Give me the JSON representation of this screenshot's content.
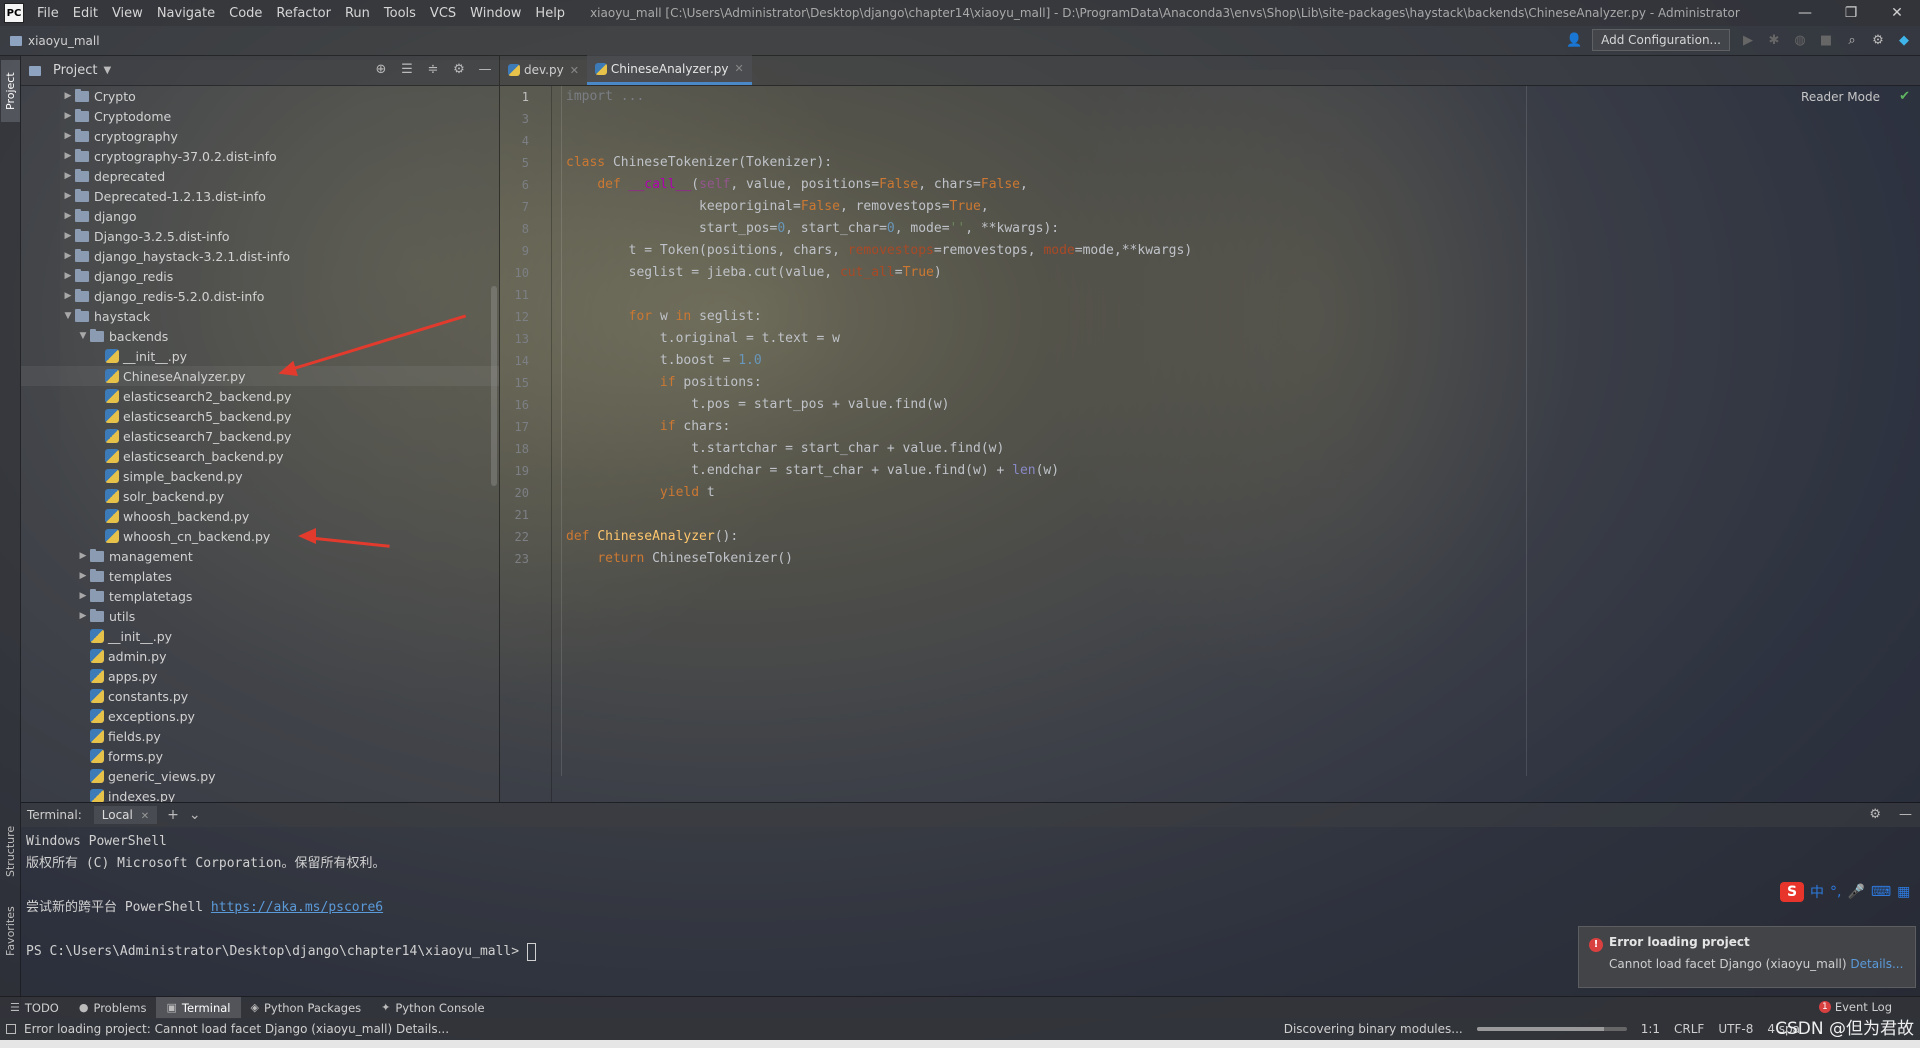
{
  "app": {
    "logo": "PC",
    "title": "xiaoyu_mall [C:\\Users\\Administrator\\Desktop\\django\\chapter14\\xiaoyu_mall] - D:\\ProgramData\\Anaconda3\\envs\\Shop\\Lib\\site-packages\\haystack\\backends\\ChineseAnalyzer.py - Administrator",
    "menu": [
      "File",
      "Edit",
      "View",
      "Navigate",
      "Code",
      "Refactor",
      "Run",
      "Tools",
      "VCS",
      "Window",
      "Help"
    ],
    "window_controls": [
      "—",
      "❐",
      "✕"
    ]
  },
  "navbar": {
    "breadcrumb": "xiaoyu_mall",
    "add_configuration": "Add Configuration..."
  },
  "left_stripe": {
    "project": "Project",
    "structure": "Structure",
    "favorites": "Favorites"
  },
  "project_panel": {
    "title": "Project",
    "tree": [
      {
        "label": "Crypto",
        "type": "folder",
        "depth": 3,
        "expanded": false
      },
      {
        "label": "Cryptodome",
        "type": "folder",
        "depth": 3,
        "expanded": false
      },
      {
        "label": "cryptography",
        "type": "folder",
        "depth": 3,
        "expanded": false
      },
      {
        "label": "cryptography-37.0.2.dist-info",
        "type": "folder",
        "depth": 3,
        "expanded": false
      },
      {
        "label": "deprecated",
        "type": "folder",
        "depth": 3,
        "expanded": false
      },
      {
        "label": "Deprecated-1.2.13.dist-info",
        "type": "folder",
        "depth": 3,
        "expanded": false
      },
      {
        "label": "django",
        "type": "folder",
        "depth": 3,
        "expanded": false
      },
      {
        "label": "Django-3.2.5.dist-info",
        "type": "folder",
        "depth": 3,
        "expanded": false
      },
      {
        "label": "django_haystack-3.2.1.dist-info",
        "type": "folder",
        "depth": 3,
        "expanded": false
      },
      {
        "label": "django_redis",
        "type": "folder",
        "depth": 3,
        "expanded": false
      },
      {
        "label": "django_redis-5.2.0.dist-info",
        "type": "folder",
        "depth": 3,
        "expanded": false
      },
      {
        "label": "haystack",
        "type": "folder",
        "depth": 3,
        "expanded": true
      },
      {
        "label": "backends",
        "type": "folder",
        "depth": 4,
        "expanded": true
      },
      {
        "label": "__init__.py",
        "type": "py",
        "depth": 5
      },
      {
        "label": "ChineseAnalyzer.py",
        "type": "py",
        "depth": 5
      },
      {
        "label": "elasticsearch2_backend.py",
        "type": "py",
        "depth": 5
      },
      {
        "label": "elasticsearch5_backend.py",
        "type": "py",
        "depth": 5
      },
      {
        "label": "elasticsearch7_backend.py",
        "type": "py",
        "depth": 5
      },
      {
        "label": "elasticsearch_backend.py",
        "type": "py",
        "depth": 5
      },
      {
        "label": "simple_backend.py",
        "type": "py",
        "depth": 5
      },
      {
        "label": "solr_backend.py",
        "type": "py",
        "depth": 5
      },
      {
        "label": "whoosh_backend.py",
        "type": "py",
        "depth": 5
      },
      {
        "label": "whoosh_cn_backend.py",
        "type": "py",
        "depth": 5
      },
      {
        "label": "management",
        "type": "folder",
        "depth": 4,
        "expanded": false
      },
      {
        "label": "templates",
        "type": "folder",
        "depth": 4,
        "expanded": false
      },
      {
        "label": "templatetags",
        "type": "folder",
        "depth": 4,
        "expanded": false
      },
      {
        "label": "utils",
        "type": "folder",
        "depth": 4,
        "expanded": false
      },
      {
        "label": "__init__.py",
        "type": "py",
        "depth": 4
      },
      {
        "label": "admin.py",
        "type": "py",
        "depth": 4
      },
      {
        "label": "apps.py",
        "type": "py",
        "depth": 4
      },
      {
        "label": "constants.py",
        "type": "py",
        "depth": 4
      },
      {
        "label": "exceptions.py",
        "type": "py",
        "depth": 4
      },
      {
        "label": "fields.py",
        "type": "py",
        "depth": 4
      },
      {
        "label": "forms.py",
        "type": "py",
        "depth": 4
      },
      {
        "label": "generic_views.py",
        "type": "py",
        "depth": 4
      },
      {
        "label": "indexes.py",
        "type": "py",
        "depth": 4
      }
    ]
  },
  "editor": {
    "tabs": [
      {
        "label": "dev.py",
        "active": false
      },
      {
        "label": "ChineseAnalyzer.py",
        "active": true
      }
    ],
    "reader_mode": "Reader Mode",
    "line_numbers": [
      "1",
      "3",
      "4",
      "5",
      "6",
      "7",
      "8",
      "9",
      "10",
      "11",
      "12",
      "13",
      "14",
      "15",
      "16",
      "17",
      "18",
      "19",
      "20",
      "21",
      "22",
      "23"
    ],
    "code": [
      [
        [
          "faded",
          "import ..."
        ]
      ],
      [],
      [],
      [
        [
          "kw",
          "class "
        ],
        [
          "plain",
          "ChineseTokenizer(Tokenizer):"
        ]
      ],
      [
        [
          "plain",
          "    "
        ],
        [
          "kw",
          "def "
        ],
        [
          "dunder",
          "__call__"
        ],
        [
          "plain",
          "("
        ],
        [
          "self",
          "self"
        ],
        [
          "plain",
          ", value, positions="
        ],
        [
          "kw",
          "False"
        ],
        [
          "plain",
          ", chars="
        ],
        [
          "kw",
          "False"
        ],
        [
          "plain",
          ","
        ]
      ],
      [
        [
          "plain",
          "                 keeporiginal="
        ],
        [
          "kw",
          "False"
        ],
        [
          "plain",
          ", removestops="
        ],
        [
          "kw",
          "True"
        ],
        [
          "plain",
          ","
        ]
      ],
      [
        [
          "plain",
          "                 start_pos="
        ],
        [
          "num",
          "0"
        ],
        [
          "plain",
          ", start_char="
        ],
        [
          "num",
          "0"
        ],
        [
          "plain",
          ", mode="
        ],
        [
          "str",
          "''"
        ],
        [
          "plain",
          ", **kwargs):"
        ]
      ],
      [
        [
          "plain",
          "        t = Token(positions, chars, "
        ],
        [
          "param",
          "removestops"
        ],
        [
          "plain",
          "=removestops, "
        ],
        [
          "param",
          "mode"
        ],
        [
          "plain",
          "=mode,**kwargs)"
        ]
      ],
      [
        [
          "plain",
          "        seglist = jieba.cut(value, "
        ],
        [
          "param",
          "cut_all"
        ],
        [
          "plain",
          "="
        ],
        [
          "kw",
          "True"
        ],
        [
          "plain",
          ")"
        ]
      ],
      [],
      [
        [
          "plain",
          "        "
        ],
        [
          "kw",
          "for "
        ],
        [
          "plain",
          "w "
        ],
        [
          "kw",
          "in "
        ],
        [
          "plain",
          "seglist:"
        ]
      ],
      [
        [
          "plain",
          "            t.original = t.text = w"
        ]
      ],
      [
        [
          "plain",
          "            t.boost = "
        ],
        [
          "num",
          "1.0"
        ]
      ],
      [
        [
          "plain",
          "            "
        ],
        [
          "kw",
          "if "
        ],
        [
          "plain",
          "positions:"
        ]
      ],
      [
        [
          "plain",
          "                t.pos = start_pos + value.find(w)"
        ]
      ],
      [
        [
          "plain",
          "            "
        ],
        [
          "kw",
          "if "
        ],
        [
          "plain",
          "chars:"
        ]
      ],
      [
        [
          "plain",
          "                t.startchar = start_char + value.find(w)"
        ]
      ],
      [
        [
          "plain",
          "                t.endchar = start_char + value.find(w) + "
        ],
        [
          "builtin",
          "len"
        ],
        [
          "plain",
          "(w)"
        ]
      ],
      [
        [
          "plain",
          "            "
        ],
        [
          "kw",
          "yield "
        ],
        [
          "plain",
          "t"
        ]
      ],
      [],
      [
        [
          "kw",
          "def "
        ],
        [
          "fn",
          "ChineseAnalyzer"
        ],
        [
          "plain",
          "():"
        ]
      ],
      [
        [
          "plain",
          "    "
        ],
        [
          "kw",
          "return "
        ],
        [
          "plain",
          "ChineseTokenizer()"
        ]
      ]
    ]
  },
  "terminal": {
    "label": "Terminal:",
    "tab": "Local",
    "lines": [
      "Windows PowerShell",
      "版权所有 (C) Microsoft Corporation。保留所有权利。",
      "",
      "尝试新的跨平台 PowerShell ",
      "",
      "PS C:\\Users\\Administrator\\Desktop\\django\\chapter14\\xiaoyu_mall> "
    ],
    "link": "https://aka.ms/pscore6"
  },
  "ime": {
    "logo": "S",
    "mode": "中"
  },
  "notification": {
    "title": "Error loading project",
    "body": "Cannot load facet Django (xiaoyu_mall) ",
    "link": "Details..."
  },
  "tool_windows": [
    {
      "label": "TODO",
      "glyph": "☰",
      "active": false
    },
    {
      "label": "Problems",
      "glyph": "●",
      "active": false
    },
    {
      "label": "Terminal",
      "glyph": "▣",
      "active": true
    },
    {
      "label": "Python Packages",
      "glyph": "◈",
      "active": false
    },
    {
      "label": "Python Console",
      "glyph": "✦",
      "active": false
    }
  ],
  "event_log": {
    "label": "Event Log",
    "count": "1"
  },
  "statusbar": {
    "message": "Error loading project: Cannot load facet Django (xiaoyu_mall) Details...",
    "task": "Discovering binary modules...",
    "progress": 0.85,
    "position": "1:1",
    "line_sep": "CRLF",
    "encoding": "UTF-8",
    "indent": "4 spa"
  },
  "watermark": "CSDN @但为君故"
}
